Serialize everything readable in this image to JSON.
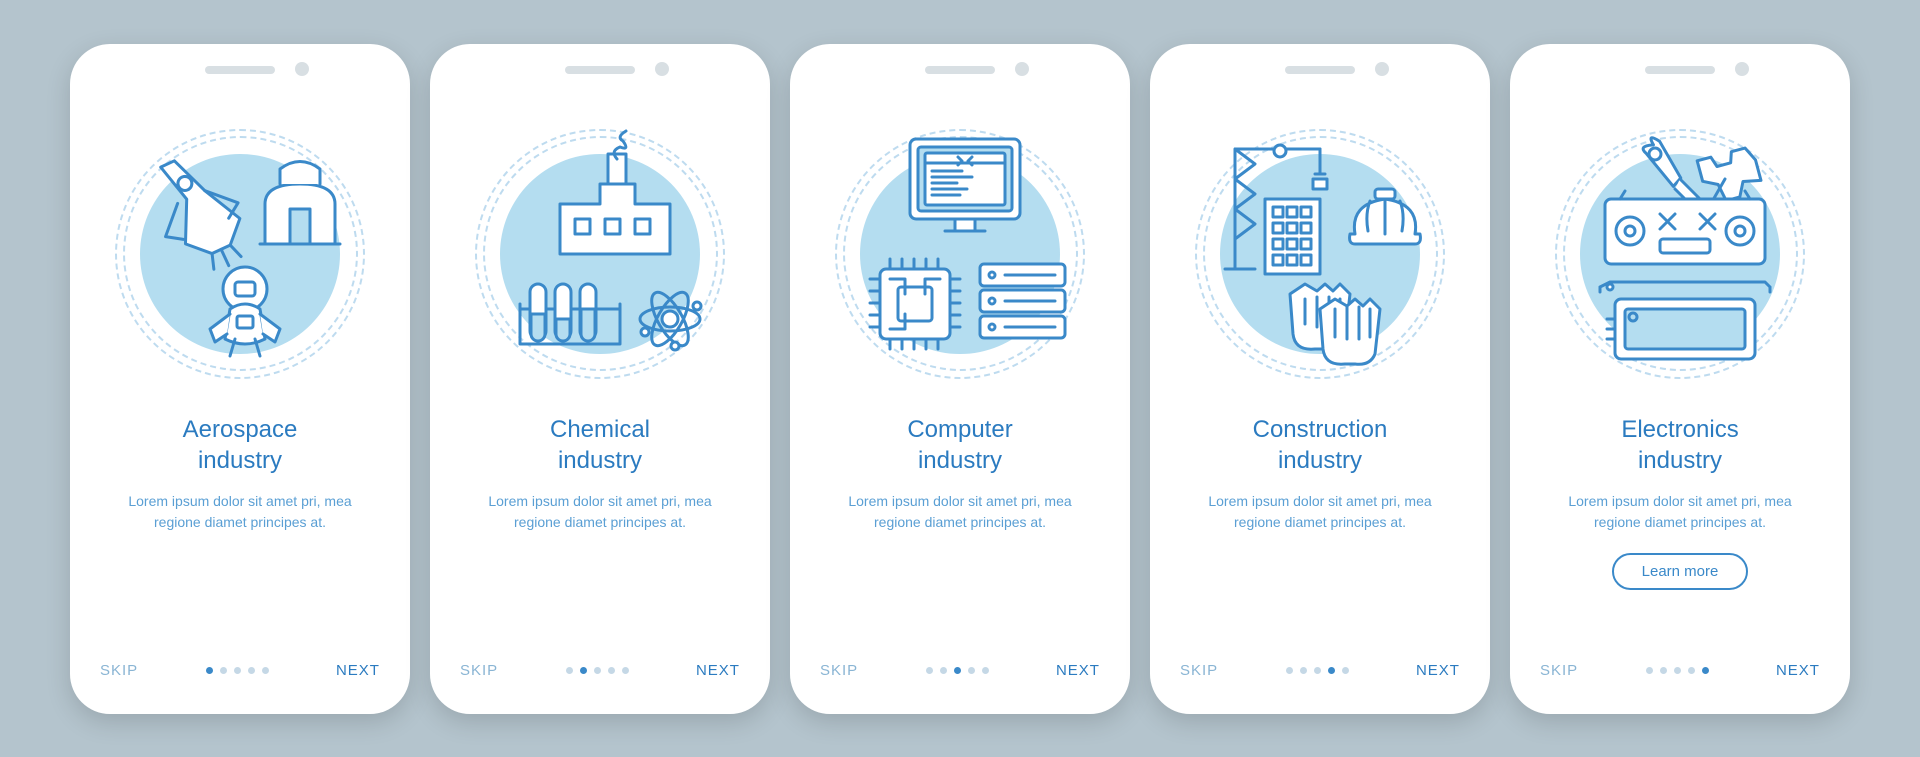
{
  "common": {
    "skip": "SKIP",
    "next": "NEXT",
    "learn_more": "Learn more",
    "desc": "Lorem ipsum dolor sit amet pri, mea regione diamet principes at."
  },
  "screens": [
    {
      "title": "Aerospace\nindustry",
      "active": 0
    },
    {
      "title": "Chemical\nindustry",
      "active": 1
    },
    {
      "title": "Computer\nindustry",
      "active": 2
    },
    {
      "title": "Construction\nindustry",
      "active": 3
    },
    {
      "title": "Electronics\nindustry",
      "active": 4,
      "cta": true
    }
  ]
}
